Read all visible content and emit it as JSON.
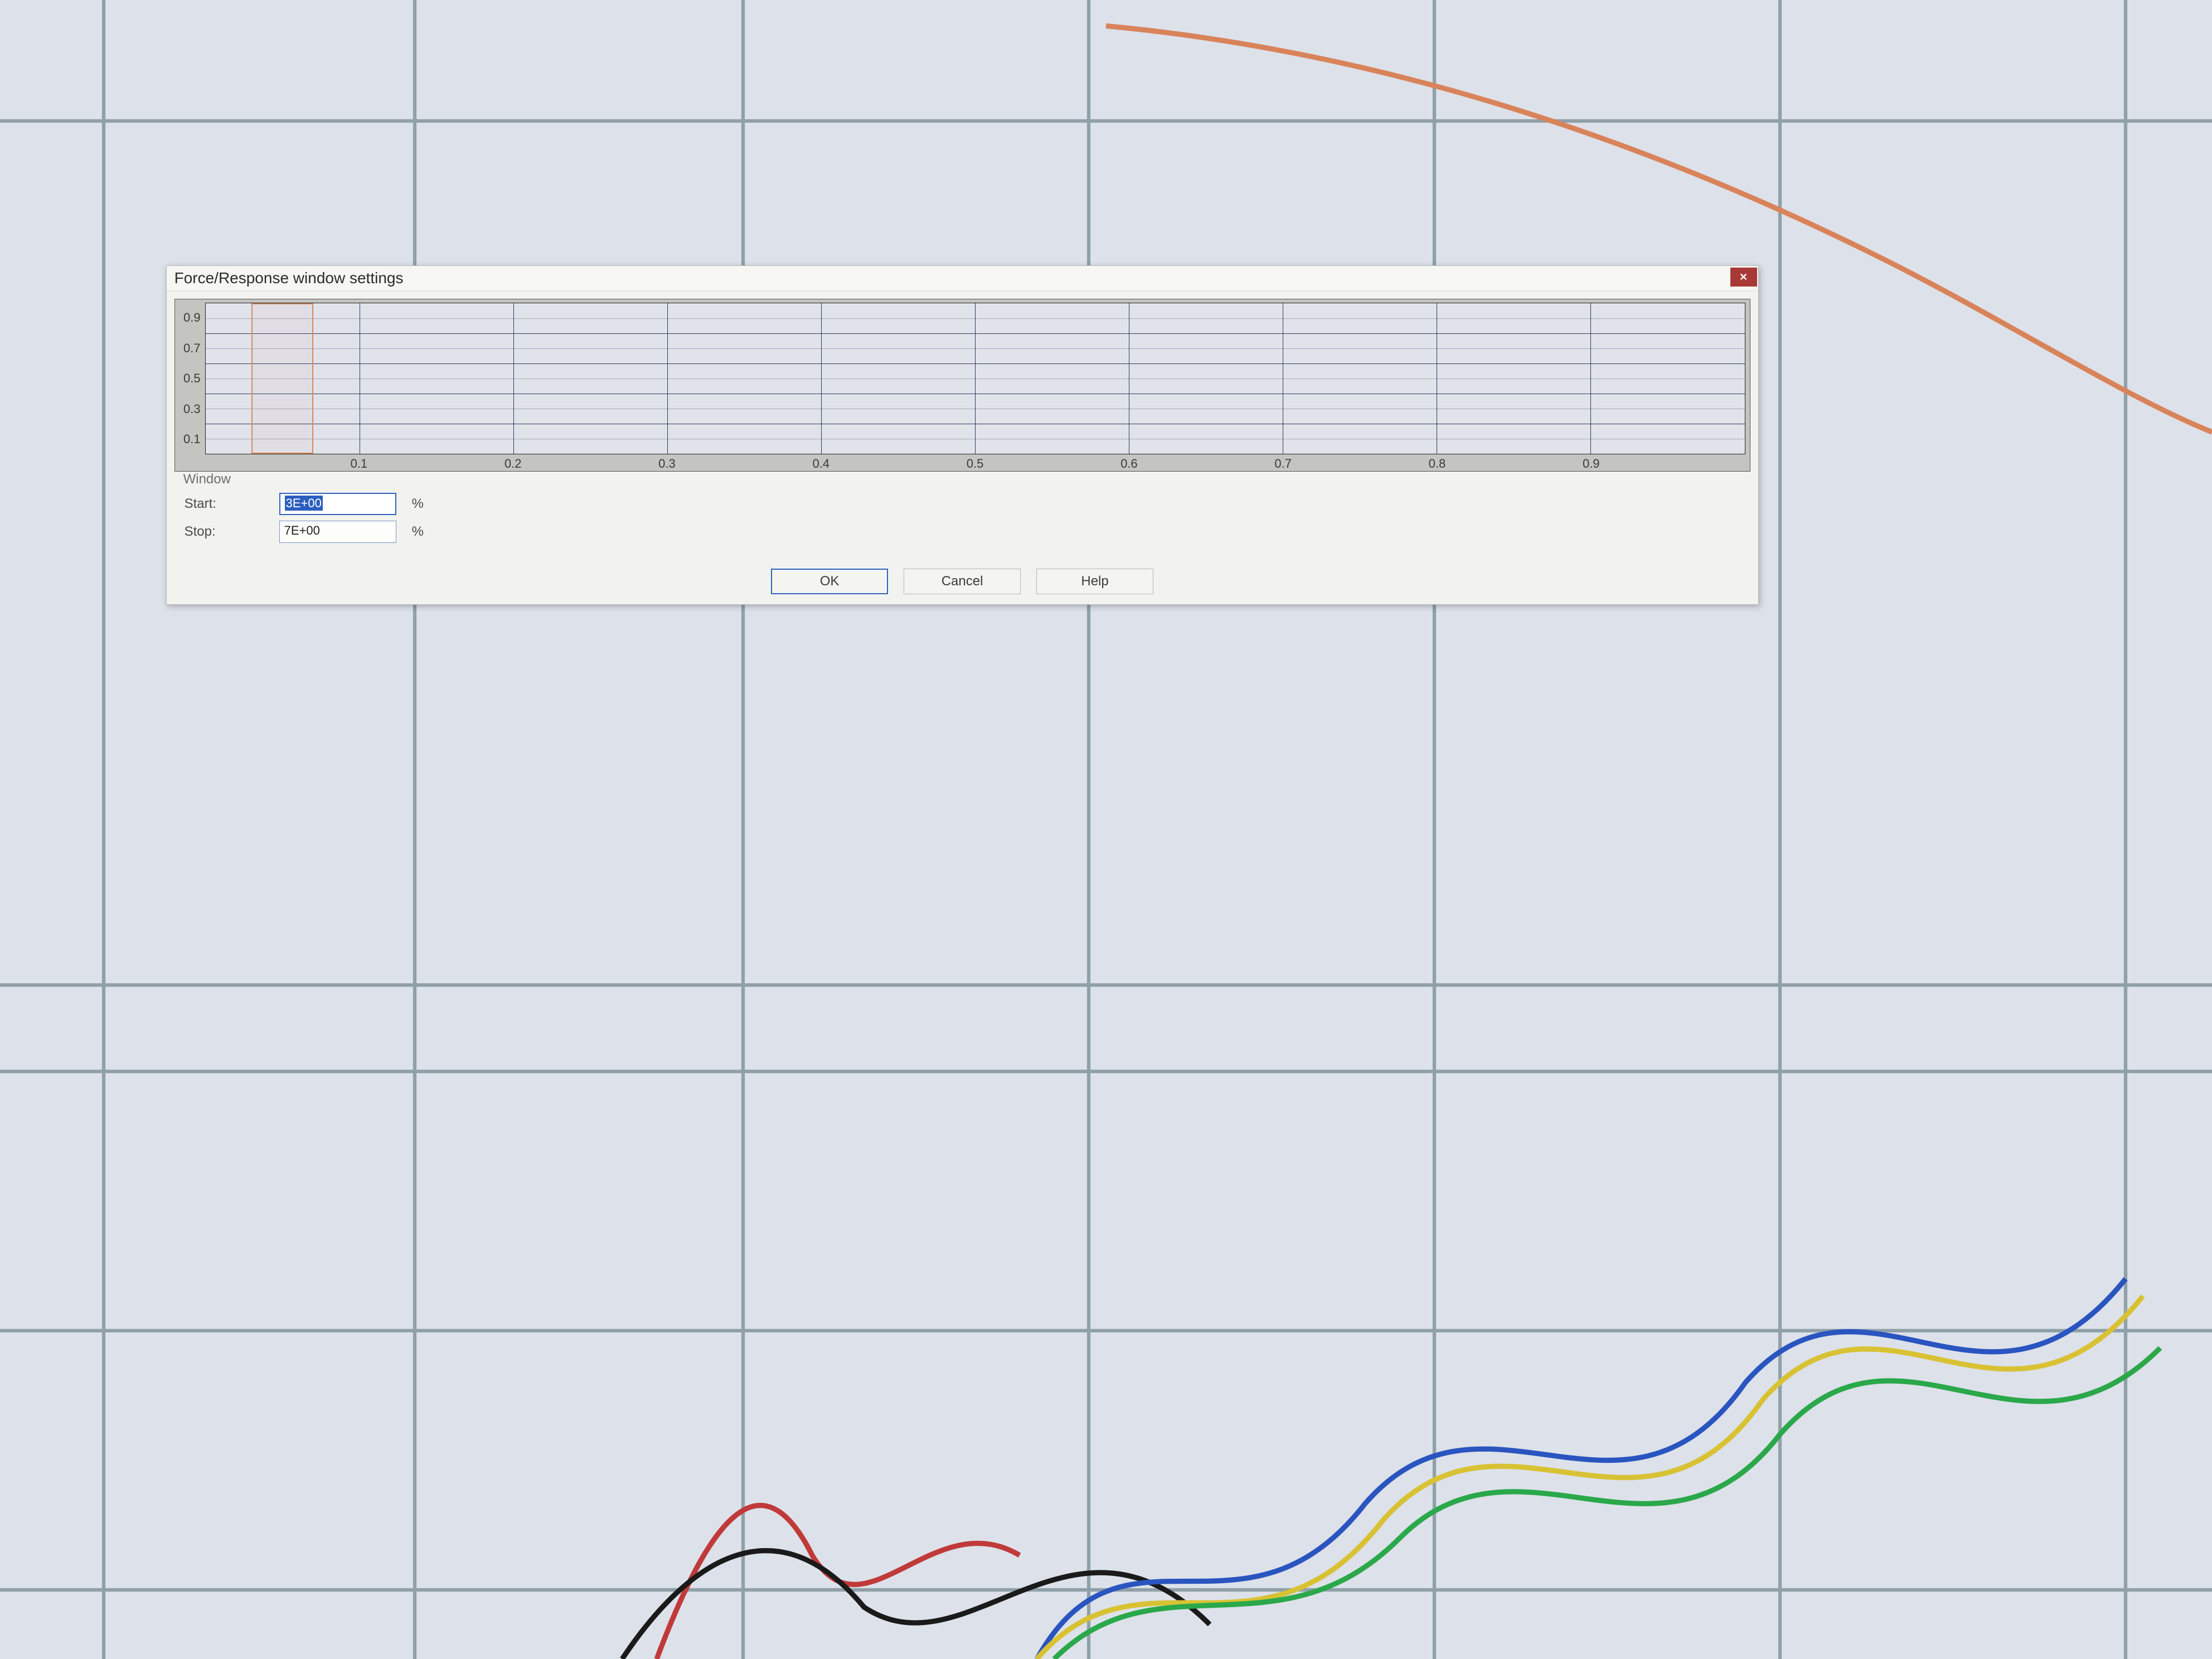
{
  "dialog": {
    "title": "Force/Response window settings",
    "close_glyph": "✕",
    "group_label": "Window",
    "start_label": "Start:",
    "start_value": "3E+00",
    "start_unit": "%",
    "stop_label": "Stop:",
    "stop_value": "7E+00",
    "stop_unit": "%",
    "ok_label": "OK",
    "cancel_label": "Cancel",
    "help_label": "Help"
  },
  "chart_data": {
    "type": "line",
    "title": "",
    "xlabel": "",
    "ylabel": "",
    "xlim": [
      0,
      1
    ],
    "ylim": [
      0,
      1
    ],
    "x_ticks": [
      0.1,
      0.2,
      0.3,
      0.4,
      0.5,
      0.6,
      0.7,
      0.8,
      0.9
    ],
    "y_ticks": [
      0.1,
      0.3,
      0.5,
      0.7,
      0.9
    ],
    "window_start_pct": 3,
    "window_stop_pct": 7,
    "series": []
  },
  "x_tick_labels": [
    "0.1",
    "0.2",
    "0.3",
    "0.4",
    "0.5",
    "0.6",
    "0.7",
    "0.8",
    "0.9"
  ],
  "y_tick_labels": [
    "0.9",
    "0.7",
    "0.5",
    "0.3",
    "0.1"
  ]
}
